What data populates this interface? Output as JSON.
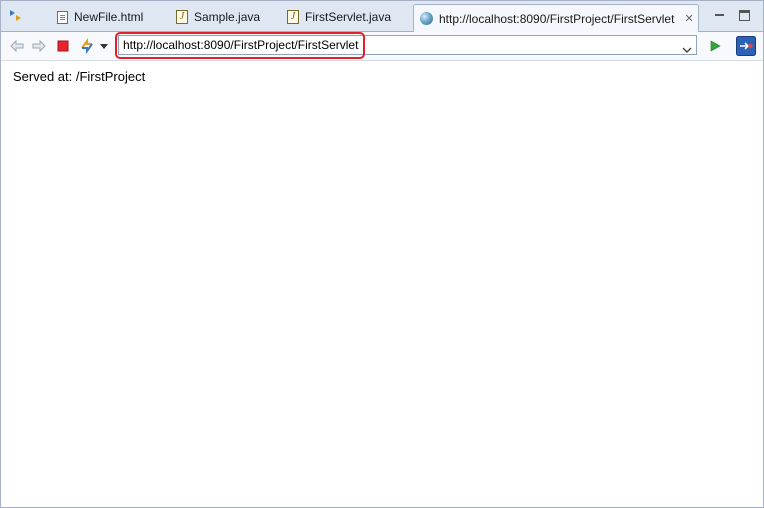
{
  "tabs": [
    {
      "label": "NewFile.html",
      "icon": "html-file-icon"
    },
    {
      "label": "Sample.java",
      "icon": "java-file-icon"
    },
    {
      "label": "FirstServlet.java",
      "icon": "java-file-icon"
    },
    {
      "label": "http://localhost:8090/FirstProject/FirstServlet",
      "icon": "globe-icon",
      "active": true
    }
  ],
  "toolbar": {
    "url_value": "http://localhost:8090/FirstProject/FirstServlet",
    "back_icon": "back-arrow-icon",
    "forward_icon": "forward-arrow-icon",
    "stop_icon": "stop-icon",
    "refresh_icon": "refresh-icon",
    "go_icon": "go-icon",
    "external_icon": "open-external-browser-icon"
  },
  "page": {
    "body_text": "Served at: /FirstProject"
  },
  "colors": {
    "highlight": "#e0202a",
    "tabbar_bg": "#dfe7f2"
  }
}
